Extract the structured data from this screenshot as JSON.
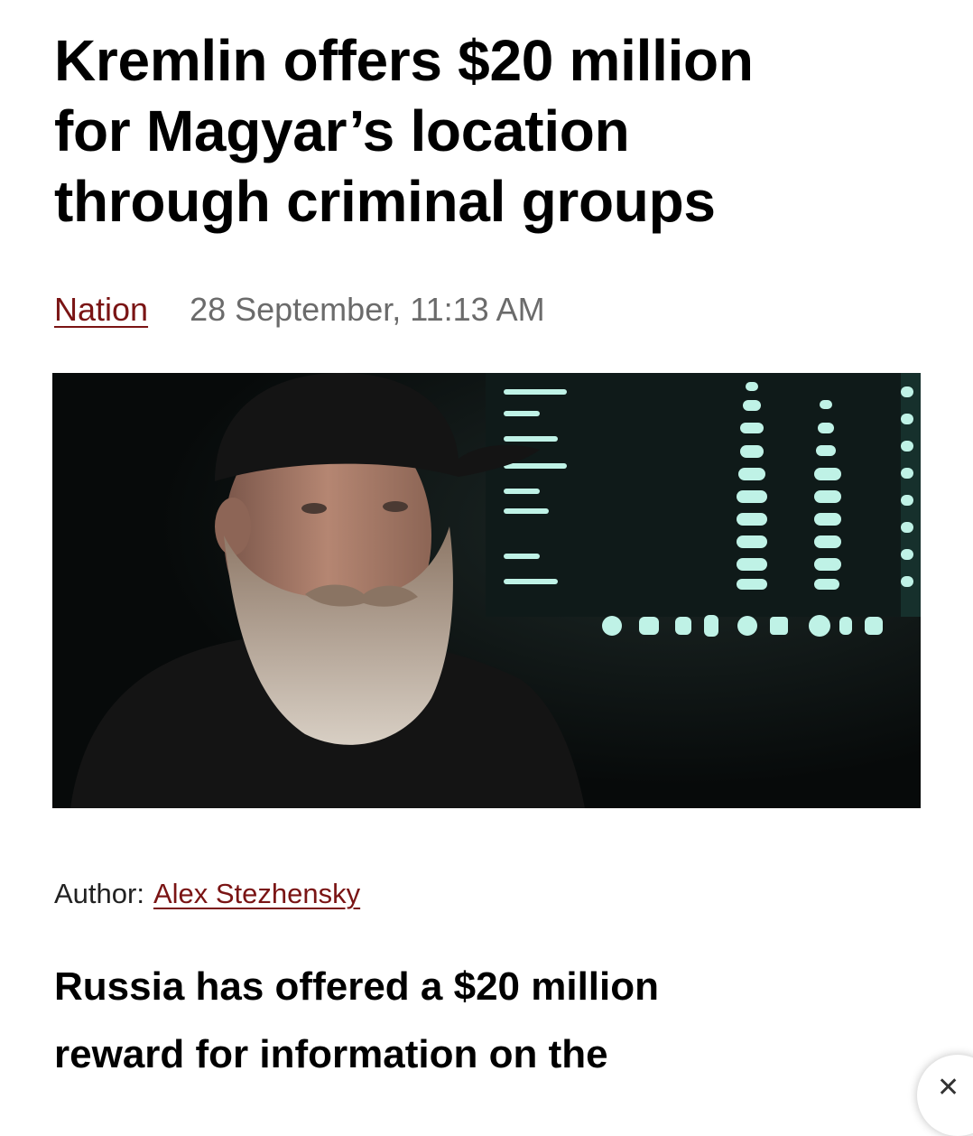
{
  "article": {
    "headline_lines": [
      "Kremlin offers $20 million",
      "for Magyar’s location",
      "through criminal groups"
    ],
    "category": "Nation",
    "date": "28 September, 11:13 AM",
    "author_label": "Author:",
    "author_name": "Alex Stezhensky",
    "lede_lines": [
      "Russia has offered a $20 million",
      "reward for information on the"
    ]
  },
  "hero_image": {
    "icon": "photo-icon",
    "depicts": "bearded-man-in-black-cap-in-front-of-screens"
  },
  "ui": {
    "share_icon": "close-icon"
  },
  "colors": {
    "link": "#7a1414",
    "date": "#6b6b6b",
    "text": "#000000",
    "screen_glow": "#bff2e6"
  }
}
